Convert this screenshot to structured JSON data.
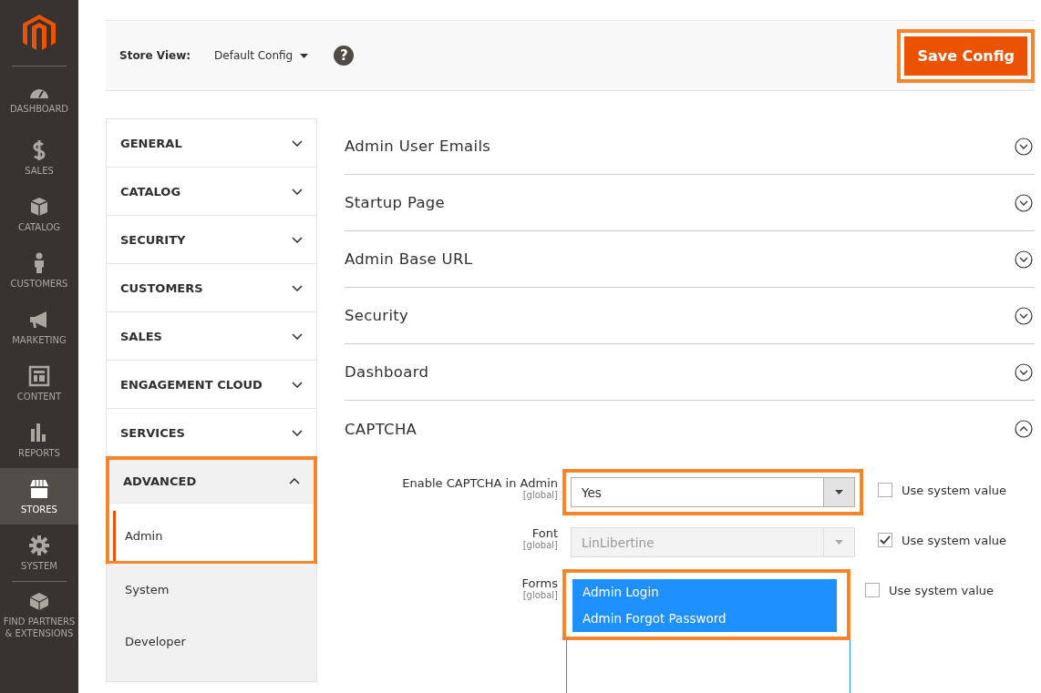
{
  "sidebar": {
    "items": [
      {
        "label": "DASHBOARD",
        "selected": false
      },
      {
        "label": "SALES",
        "selected": false
      },
      {
        "label": "CATALOG",
        "selected": false
      },
      {
        "label": "CUSTOMERS",
        "selected": false
      },
      {
        "label": "MARKETING",
        "selected": false
      },
      {
        "label": "CONTENT",
        "selected": false
      },
      {
        "label": "REPORTS",
        "selected": false
      },
      {
        "label": "STORES",
        "selected": true
      },
      {
        "label": "SYSTEM",
        "selected": false
      },
      {
        "label": "FIND PARTNERS & EXTENSIONS",
        "selected": false
      }
    ]
  },
  "header": {
    "store_view_label": "Store View:",
    "store_view_value": "Default Config",
    "help": "?",
    "save_button": {
      "label": "Save Config",
      "highlighted": true
    }
  },
  "nav": {
    "groups": [
      {
        "label": "GENERAL",
        "expanded": false,
        "highlighted": false
      },
      {
        "label": "CATALOG",
        "expanded": false,
        "highlighted": false
      },
      {
        "label": "SECURITY",
        "expanded": false,
        "highlighted": false
      },
      {
        "label": "CUSTOMERS",
        "expanded": false,
        "highlighted": false
      },
      {
        "label": "SALES",
        "expanded": false,
        "highlighted": false
      },
      {
        "label": "ENGAGEMENT CLOUD",
        "expanded": false,
        "highlighted": false
      },
      {
        "label": "SERVICES",
        "expanded": false,
        "highlighted": false
      },
      {
        "label": "ADVANCED",
        "expanded": true,
        "highlighted": true,
        "children": [
          {
            "label": "Admin",
            "selected": true
          },
          {
            "label": "System",
            "selected": false
          },
          {
            "label": "Developer",
            "selected": false
          }
        ]
      }
    ]
  },
  "sections": [
    {
      "title": "Admin User Emails",
      "expanded": false
    },
    {
      "title": "Startup Page",
      "expanded": false
    },
    {
      "title": "Admin Base URL",
      "expanded": false
    },
    {
      "title": "Security",
      "expanded": false
    },
    {
      "title": "Dashboard",
      "expanded": false
    },
    {
      "title": "CAPTCHA",
      "expanded": true,
      "fields": [
        {
          "kind": "select",
          "label": "Enable CAPTCHA in Admin",
          "scope": "[global]",
          "value": "Yes",
          "disabled": false,
          "highlighted": true,
          "use_system_value": {
            "label": "Use system value",
            "checked": false
          }
        },
        {
          "kind": "select",
          "label": "Font",
          "scope": "[global]",
          "value": "LinLibertine",
          "disabled": true,
          "highlighted": false,
          "use_system_value": {
            "label": "Use system value",
            "checked": true
          }
        },
        {
          "kind": "multiselect",
          "label": "Forms",
          "scope": "[global]",
          "options": [
            {
              "label": "Admin Login",
              "selected": true
            },
            {
              "label": "Admin Forgot Password",
              "selected": true
            }
          ],
          "disabled": false,
          "highlighted": true,
          "use_system_value": {
            "label": "Use system value",
            "checked": false
          }
        }
      ]
    }
  ]
}
